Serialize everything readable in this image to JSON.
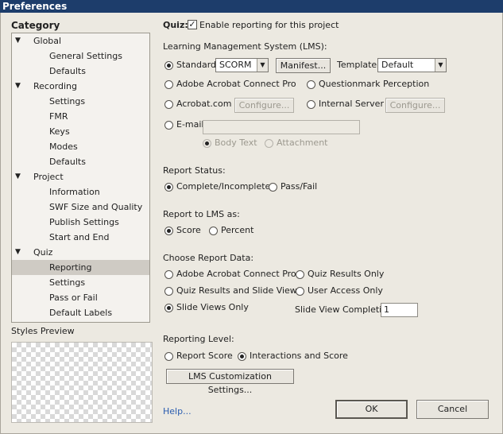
{
  "window": {
    "title": "Preferences"
  },
  "category": {
    "label": "Category",
    "items": [
      {
        "label": "Global",
        "expanded": true
      },
      {
        "label": "General Settings"
      },
      {
        "label": "Defaults"
      },
      {
        "label": "Recording",
        "expanded": true
      },
      {
        "label": "Settings"
      },
      {
        "label": "FMR"
      },
      {
        "label": "Keys"
      },
      {
        "label": "Modes"
      },
      {
        "label": "Defaults"
      },
      {
        "label": "Project",
        "expanded": true
      },
      {
        "label": "Information"
      },
      {
        "label": "SWF Size and Quality"
      },
      {
        "label": "Publish Settings"
      },
      {
        "label": "Start and End"
      },
      {
        "label": "Quiz",
        "expanded": true
      },
      {
        "label": "Reporting",
        "selected": true
      },
      {
        "label": "Settings"
      },
      {
        "label": "Pass or Fail"
      },
      {
        "label": "Default Labels"
      }
    ]
  },
  "styles_preview": {
    "label": "Styles Preview"
  },
  "quiz": {
    "label": "Quiz:",
    "enable_reporting_label": "Enable reporting for this project",
    "enable_reporting_checked": true
  },
  "lms": {
    "heading": "Learning Management System (LMS):",
    "standard_label": "Standard:",
    "standard_value": "SCORM",
    "manifest_button": "Manifest...",
    "template_label": "Template:",
    "template_value": "Default",
    "adobe_connect_label": "Adobe Acrobat Connect Pro",
    "questionmark_label": "Questionmark Perception",
    "acrobat_com_label": "Acrobat.com",
    "configure_button_1": "Configure...",
    "internal_server_label": "Internal Server",
    "configure_button_2": "Configure...",
    "email_label": "E-mail:",
    "email_value": "",
    "body_text_label": "Body Text",
    "attachment_label": "Attachment",
    "selected": "Standard"
  },
  "report_status": {
    "heading": "Report Status:",
    "options": [
      "Complete/Incomplete",
      "Pass/Fail"
    ],
    "selected": "Complete/Incomplete"
  },
  "report_to_lms": {
    "heading": "Report to LMS as:",
    "options": [
      "Score",
      "Percent"
    ],
    "selected": "Score"
  },
  "report_data": {
    "heading": "Choose Report Data:",
    "options": [
      "Adobe Acrobat Connect Pro",
      "Quiz Results Only",
      "Quiz Results and Slide Views",
      "User Access Only",
      "Slide Views Only"
    ],
    "selected": "Slide Views Only",
    "slide_view_completion_label": "Slide View Completion",
    "slide_view_completion_value": "1"
  },
  "reporting_level": {
    "heading": "Reporting Level:",
    "options": [
      "Report Score",
      "Interactions and Score"
    ],
    "selected": "Interactions and Score",
    "customization_button": "LMS Customization Settings..."
  },
  "footer": {
    "help_link": "Help...",
    "ok_button": "OK",
    "cancel_button": "Cancel"
  }
}
